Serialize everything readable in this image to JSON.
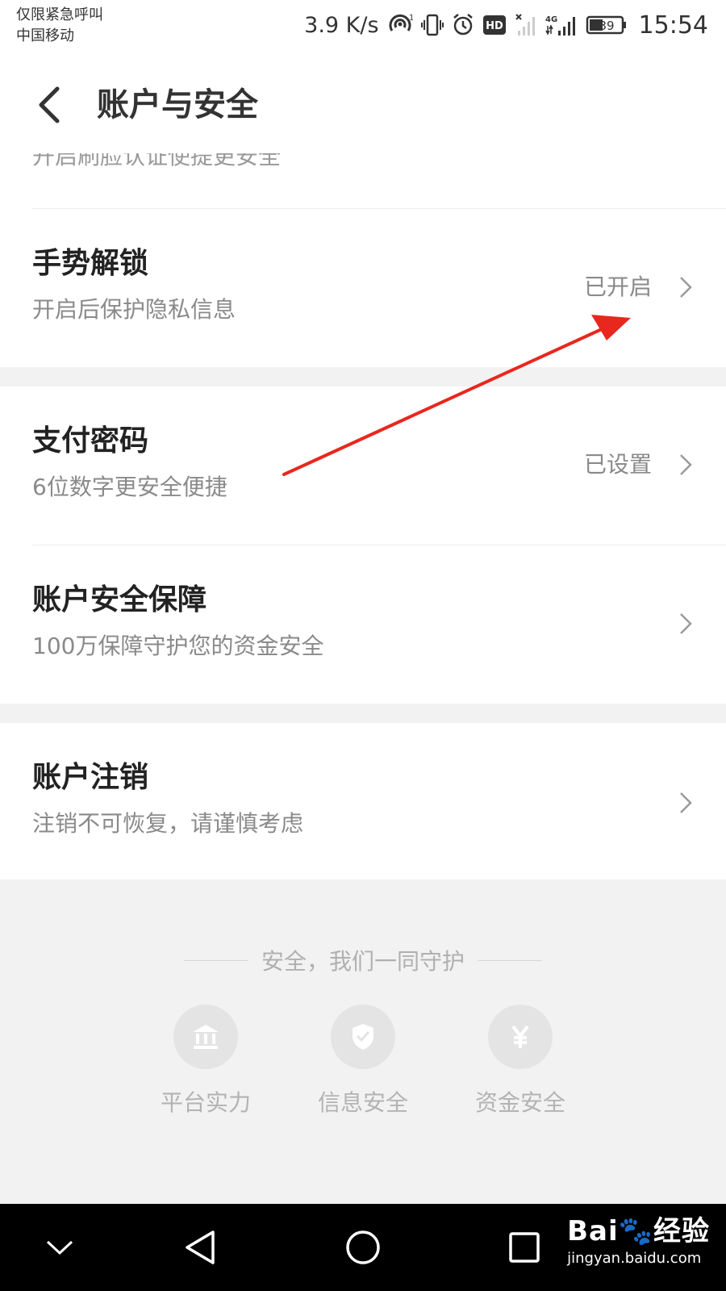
{
  "status_bar": {
    "carrier_line1": "仅限紧急呼叫",
    "carrier_line2": "中国移动",
    "net_speed": "3.9 K/s",
    "hd_badge": "HD",
    "network_type": "4G",
    "battery": "39",
    "time": "15:54",
    "icons": [
      "hotspot-icon",
      "vibrate-icon",
      "alarm-icon",
      "hd-icon",
      "no-signal-icon",
      "signal-icon",
      "battery-icon"
    ]
  },
  "header": {
    "title": "账户与安全",
    "back_icon": "back-arrow-icon"
  },
  "cut_row": {
    "subtitle": "开启刷脸认证使提更安全"
  },
  "rows": [
    {
      "title": "手势解锁",
      "subtitle": "开启后保护隐私信息",
      "status": "已开启"
    },
    {
      "title": "支付密码",
      "subtitle": "6位数字更安全便捷",
      "status": "已设置"
    },
    {
      "title": "账户安全保障",
      "subtitle": "100万保障守护您的资金安全",
      "status": ""
    },
    {
      "title": "账户注销",
      "subtitle": "注销不可恢复，请谨慎考虑",
      "status": ""
    }
  ],
  "footer": {
    "tagline": "安全，我们一同守护",
    "features": [
      {
        "label": "平台实力",
        "icon": "bank-icon"
      },
      {
        "label": "信息安全",
        "icon": "shield-check-icon"
      },
      {
        "label": "资金安全",
        "icon": "yuan-icon"
      }
    ]
  },
  "nav": {
    "buttons": [
      "chevron-down-icon",
      "back-triangle-icon",
      "home-circle-icon",
      "recents-square-icon"
    ]
  },
  "watermark": {
    "logo": "Bai🐾经验",
    "url": "jingyan.baidu.com"
  },
  "colors": {
    "background": "#ffffff",
    "section_gap": "#f2f2f2",
    "title_text": "#222222",
    "secondary_text": "#8a8a8a",
    "annotation_arrow": "#e8281e",
    "navbar": "#000000"
  }
}
